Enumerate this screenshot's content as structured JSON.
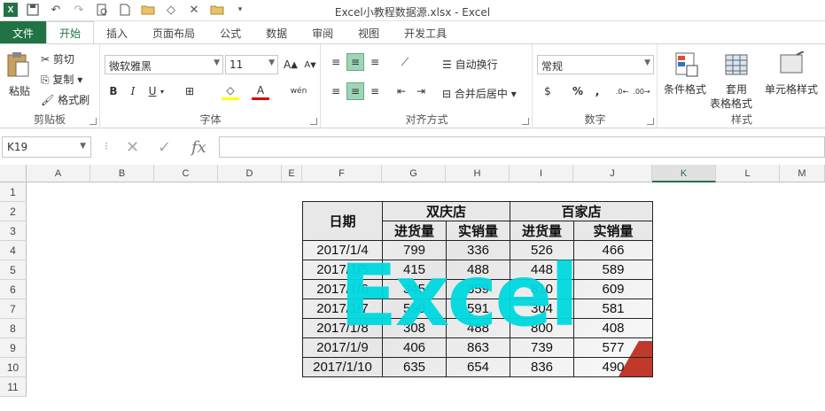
{
  "window": {
    "title": "Excel小教程数据源.xlsx - Excel"
  },
  "qat": {
    "excel_icon": "excel-logo",
    "undo": "↶",
    "redo": "↷"
  },
  "tabs": [
    "文件",
    "开始",
    "插入",
    "页面布局",
    "公式",
    "数据",
    "审阅",
    "视图",
    "开发工具"
  ],
  "ribbon": {
    "clipboard": {
      "paste": "粘贴",
      "cut": "剪切",
      "copy": "复制",
      "format_painter": "格式刷",
      "label": "剪贴板"
    },
    "font": {
      "name": "微软雅黑",
      "size": "11",
      "bold": "B",
      "italic": "I",
      "underline": "U",
      "label": "字体",
      "wen": "wén"
    },
    "alignment": {
      "wrap": "自动换行",
      "merge": "合并后居中",
      "label": "对齐方式"
    },
    "number": {
      "format": "常规",
      "percent": "%",
      "comma": ",",
      "label": "数字"
    },
    "styles": {
      "conditional": "条件格式",
      "table_format_line1": "套用",
      "table_format_line2": "表格格式",
      "cell_styles": "单元格样式",
      "label": "样式"
    }
  },
  "formula_bar": {
    "name_box": "K19",
    "fx": "fx",
    "value": ""
  },
  "columns": [
    "A",
    "B",
    "C",
    "D",
    "E",
    "F",
    "G",
    "H",
    "I",
    "J",
    "K",
    "L",
    "M"
  ],
  "rows": [
    "1",
    "2",
    "3",
    "4",
    "5",
    "6",
    "7",
    "8",
    "9",
    "10",
    "11"
  ],
  "table": {
    "date_header": "日期",
    "store1": "双庆店",
    "store2": "百家店",
    "sub": [
      "进货量",
      "实销量",
      "进货量",
      "实销量"
    ],
    "rows": [
      [
        "2017/1/4",
        "799",
        "336",
        "526",
        "466"
      ],
      [
        "2017/1/5",
        "415",
        "488",
        "448",
        "589"
      ],
      [
        "2017/1/6",
        "345",
        "359",
        "810",
        "609"
      ],
      [
        "2017/1/7",
        "550",
        "591",
        "304",
        "581"
      ],
      [
        "2017/1/8",
        "308",
        "488",
        "800",
        "408"
      ],
      [
        "2017/1/9",
        "406",
        "863",
        "739",
        "577"
      ],
      [
        "2017/1/10",
        "635",
        "654",
        "836",
        "490"
      ]
    ]
  },
  "watermark": {
    "text": "Excel",
    "color": "#00d9e0"
  },
  "colors": {
    "accent": "#217346",
    "selected_align": "#9fd5b7"
  }
}
